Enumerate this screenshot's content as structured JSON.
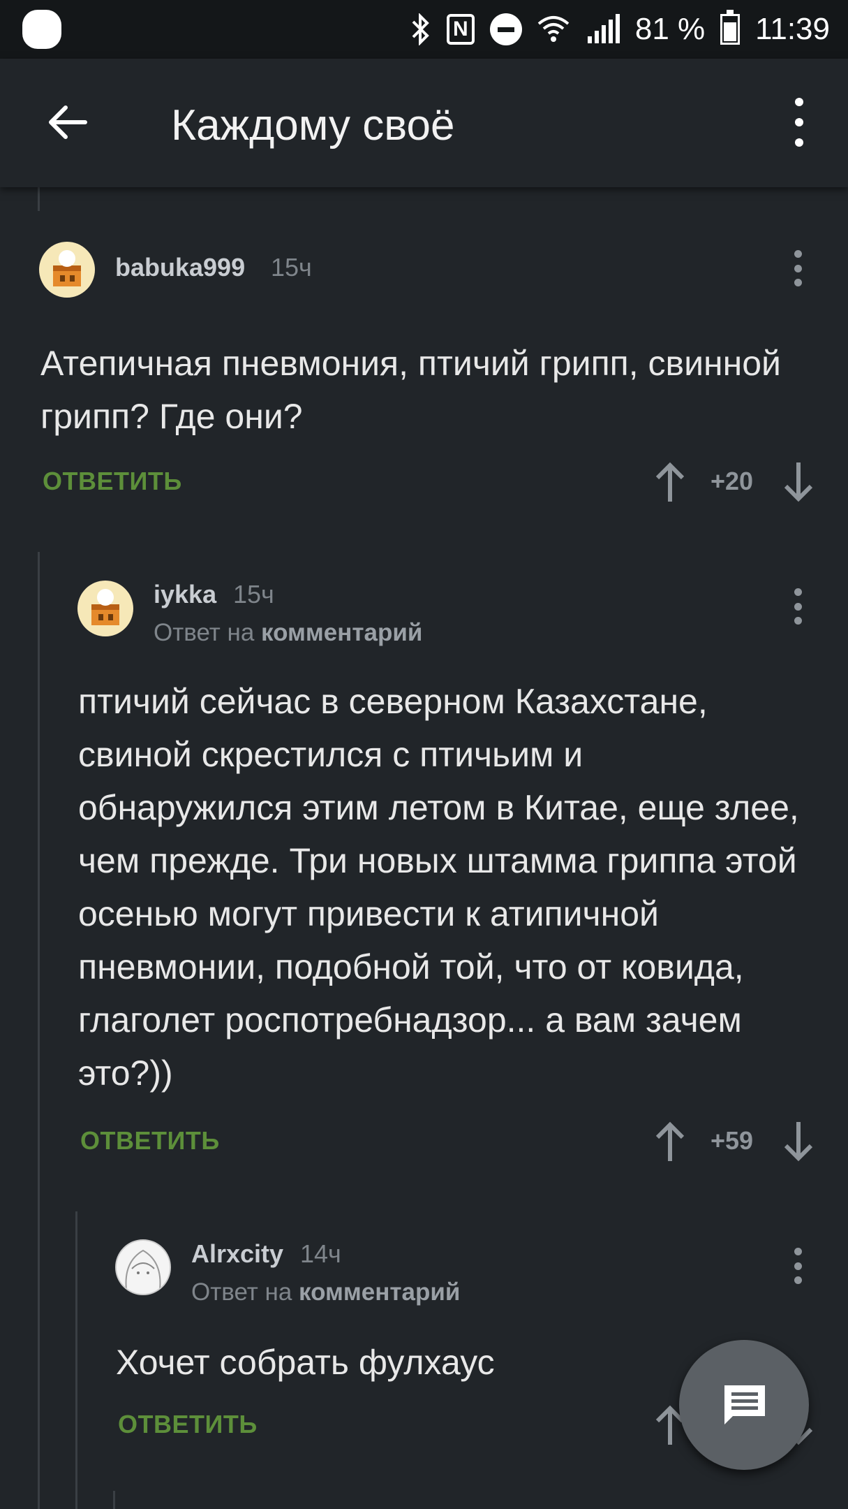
{
  "status_bar": {
    "battery": "81 %",
    "time": "11:39",
    "icons": [
      "bluetooth-icon",
      "nfc-icon",
      "do-not-disturb-icon",
      "wifi-icon",
      "signal-icon",
      "battery-icon"
    ]
  },
  "toolbar": {
    "title": "Каждому своё",
    "icons": [
      "back-arrow-icon",
      "more-vert-icon"
    ]
  },
  "colors": {
    "background": "#212529",
    "reply_link": "#5d8f3a",
    "muted": "#7f858b"
  },
  "comments": [
    {
      "author": "babuka999",
      "time": "15ч",
      "text": "Атепичная пневмония, птичий грипп, свинной грипп? Где они?",
      "reply_label": "ОТВЕТИТЬ",
      "score": "+20"
    },
    {
      "author": "iykka",
      "time": "15ч",
      "reply_prefix": "Ответ на",
      "reply_target": "комментарий",
      "text": "птичий сейчас в северном Казахстане, свиной скрестился с птичьим и обнаружился этим летом в Китае, еще злее, чем прежде. Три новых штамма гриппа этой осенью могут привести к атипичной пневмонии, подобной той, что от ковида, глаголет роспотребнадзор... а вам зачем это?))",
      "reply_label": "ОТВЕТИТЬ",
      "score": "+59"
    },
    {
      "author": "Alrxcity",
      "time": "14ч",
      "reply_prefix": "Ответ на",
      "reply_target": "комментарий",
      "text": "Хочет собрать фулхаус",
      "reply_label": "ОТВЕТИТЬ"
    }
  ],
  "fab": {
    "icon": "comment-icon"
  }
}
